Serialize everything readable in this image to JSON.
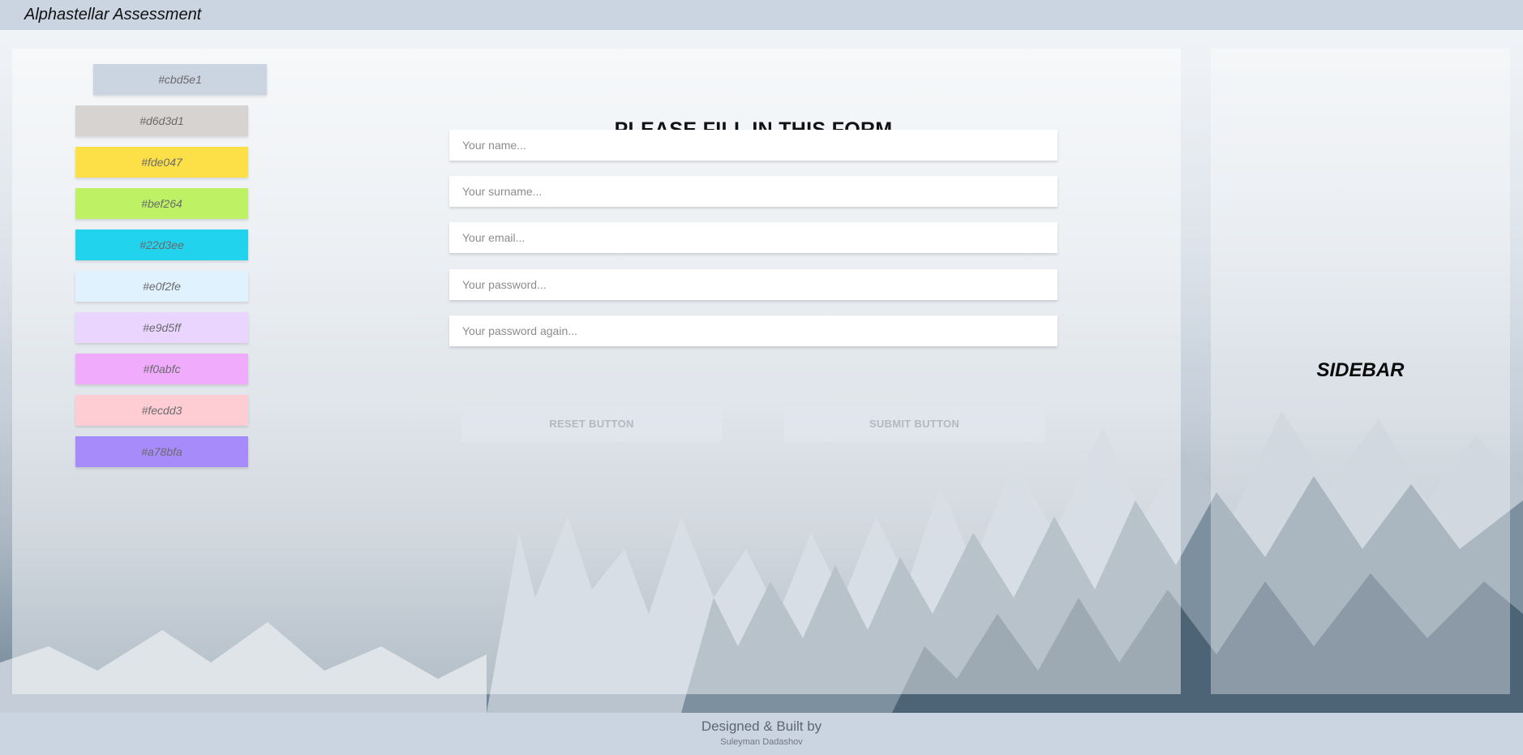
{
  "header": {
    "title": "Alphastellar Assessment"
  },
  "swatches": [
    {
      "label": "#cbd5e1",
      "color": "#cbd5e1"
    },
    {
      "label": "#d6d3d1",
      "color": "#d6d3d1"
    },
    {
      "label": "#fde047",
      "color": "#fde047"
    },
    {
      "label": "#bef264",
      "color": "#bef264"
    },
    {
      "label": "#22d3ee",
      "color": "#22d3ee"
    },
    {
      "label": "#e0f2fe",
      "color": "#e0f2fe"
    },
    {
      "label": "#e9d5ff",
      "color": "#e9d5ff"
    },
    {
      "label": "#f0abfc",
      "color": "#f0abfc"
    },
    {
      "label": "#fecdd3",
      "color": "#fecdd3"
    },
    {
      "label": "#a78bfa",
      "color": "#a78bfa"
    }
  ],
  "form": {
    "title": "PLEASE FILL IN THIS FORM",
    "name_placeholder": "Your name...",
    "surname_placeholder": "Your surname...",
    "email_placeholder": "Your email...",
    "password_placeholder": "Your password...",
    "password_again_placeholder": "Your password again...",
    "reset_label": "RESET BUTTON",
    "submit_label": "SUBMIT BUTTON"
  },
  "sidebar": {
    "title": "SIDEBAR"
  },
  "footer": {
    "line1": "Designed & Built by",
    "line2": "Suleyman Dadashov"
  }
}
